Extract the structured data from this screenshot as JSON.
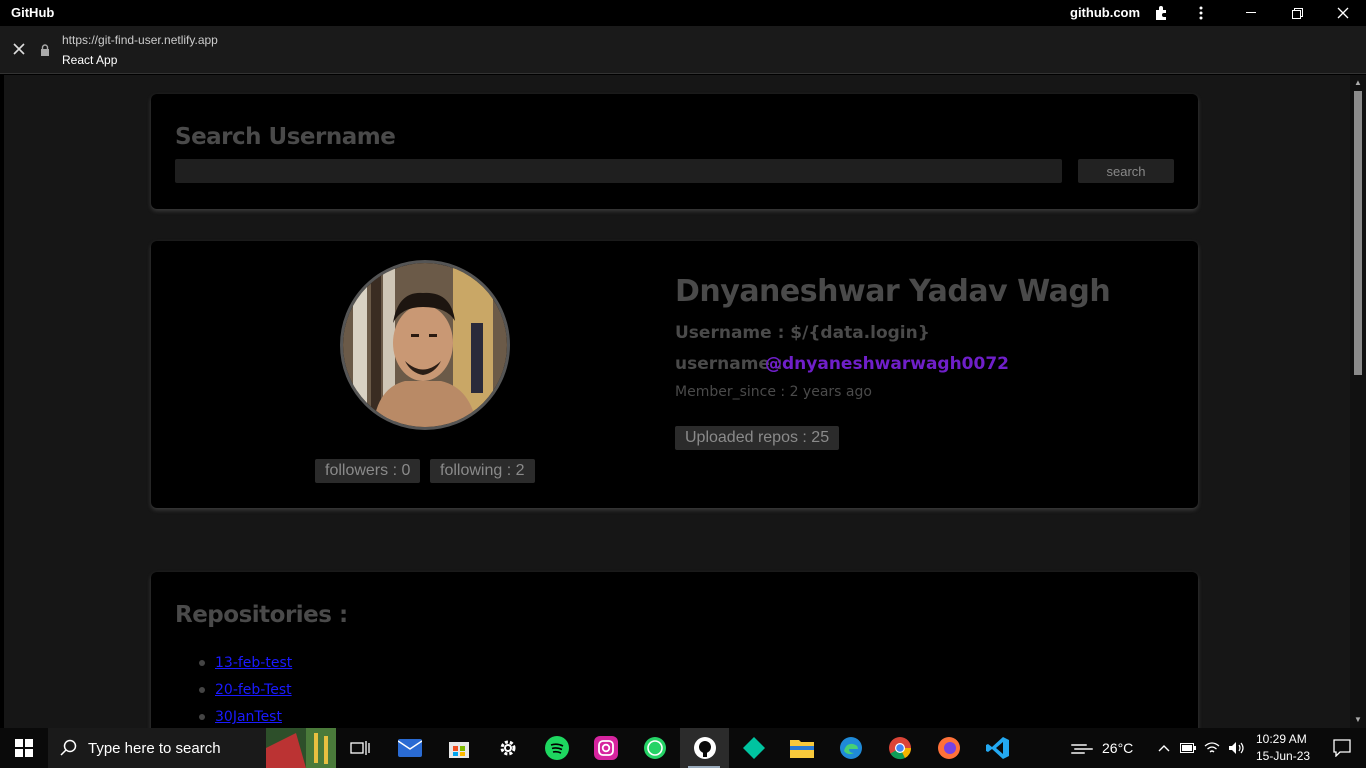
{
  "window": {
    "app_title": "GitHub",
    "domain": "github.com"
  },
  "urlbar": {
    "url": "https://git-find-user.netlify.app",
    "page_title": "React App"
  },
  "search": {
    "heading": "Search Username",
    "input_value": "",
    "button_label": "search"
  },
  "profile": {
    "full_name": "Dnyaneshwar Yadav Wagh",
    "username_line": "Username : $/{data.login}",
    "username_label": "username :",
    "username_link": "@dnyaneshwarwagh0072",
    "member_since": "Member_since : 2 years ago",
    "followers": "followers : 0",
    "following": "following : 2",
    "uploaded_repos": "Uploaded repos : 25"
  },
  "repositories": {
    "heading": "Repositories :",
    "items": [
      "13-feb-test",
      "20-feb-Test",
      "30JanTest"
    ]
  },
  "taskbar": {
    "search_placeholder": "Type here to search",
    "weather": "26°C",
    "time": "10:29 AM",
    "date": "15-Jun-23"
  },
  "colors": {
    "accent_link": "#6f1fc9",
    "repo_link": "#1a1aff"
  }
}
